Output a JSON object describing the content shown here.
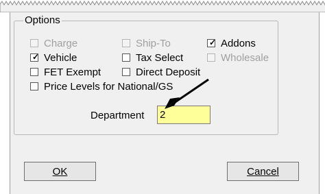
{
  "group": {
    "title": "Options"
  },
  "options": [
    {
      "label": "Charge",
      "checked": false,
      "enabled": false
    },
    {
      "label": "Ship-To",
      "checked": false,
      "enabled": false
    },
    {
      "label": "Addons",
      "checked": true,
      "enabled": true
    },
    {
      "label": "Vehicle",
      "checked": true,
      "enabled": true
    },
    {
      "label": "Tax Select",
      "checked": false,
      "enabled": true
    },
    {
      "label": "Wholesale",
      "checked": false,
      "enabled": false
    },
    {
      "label": "FET Exempt",
      "checked": false,
      "enabled": true
    },
    {
      "label": "Direct Deposit",
      "checked": false,
      "enabled": true
    },
    {
      "label": "Price Levels for National/GS",
      "checked": false,
      "enabled": true
    }
  ],
  "department": {
    "label": "Department",
    "value": "2"
  },
  "buttons": {
    "ok": "OK",
    "cancel": "Cancel"
  },
  "colors": {
    "field_highlight": "#ffff99",
    "disabled_text": "#a0a0a0"
  }
}
